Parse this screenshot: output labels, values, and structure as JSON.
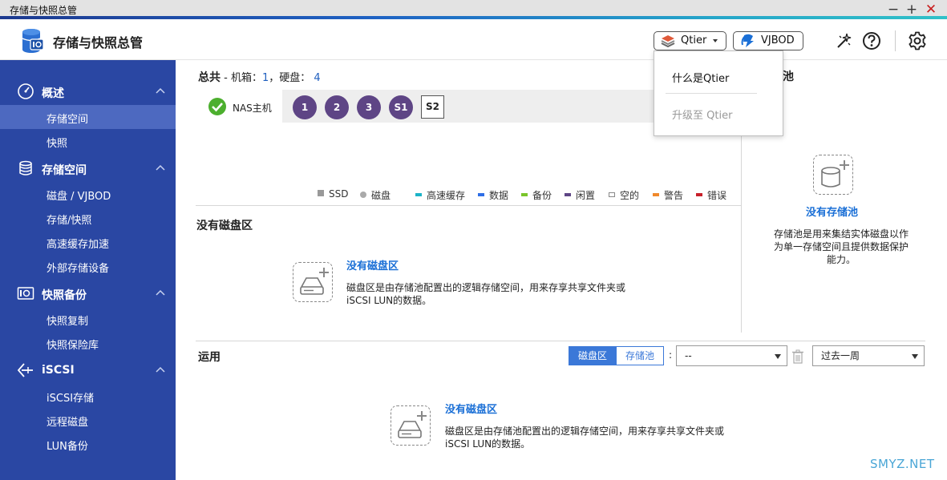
{
  "window": {
    "title": "存储与快照总管",
    "minimize": "−",
    "maximize": "+",
    "close": "✕"
  },
  "header": {
    "app_title": "存储与快照总管",
    "qtier_label": "Qtier",
    "vjbod_label": "VJBOD"
  },
  "qtier_menu": {
    "items": [
      {
        "label": "什么是Qtier",
        "enabled": true
      },
      {
        "label": "升级至 Qtier",
        "enabled": false
      }
    ]
  },
  "sidebar": {
    "sections": [
      {
        "label": "概述",
        "icon": "gauge-icon",
        "items": [
          "存储空间",
          "快照"
        ]
      },
      {
        "label": "存储空间",
        "icon": "database-icon",
        "items": [
          "磁盘 / VJBOD",
          "存储/快照",
          "高速缓存加速",
          "外部存储设备"
        ]
      },
      {
        "label": "快照备份",
        "icon": "camera-icon",
        "items": [
          "快照复制",
          "快照保险库"
        ]
      },
      {
        "label": "iSCSI",
        "icon": "iscsi-icon",
        "items": [
          "iSCSI存储",
          "远程磁盘",
          "LUN备份"
        ]
      }
    ],
    "active_item": "存储空间"
  },
  "summary": {
    "total_label": "总共",
    "enclosure_label": "- 机箱：",
    "enclosure_count": "1",
    "separator": "，",
    "disk_label": "硬盘：",
    "disk_count": "4",
    "nas_label": "NAS主机",
    "disks": [
      "1",
      "2",
      "3",
      "S1",
      "S2"
    ]
  },
  "legend": [
    {
      "label": "SSD",
      "color": "#999999",
      "shape": "square"
    },
    {
      "label": "磁盘",
      "color": "#aaaaaa",
      "shape": "circle"
    },
    {
      "label": "高速缓存",
      "color": "#1bb3c8",
      "shape": "bar"
    },
    {
      "label": "数据",
      "color": "#2e6ee6",
      "shape": "bar"
    },
    {
      "label": "备份",
      "color": "#7ac52a",
      "shape": "bar"
    },
    {
      "label": "闲置",
      "color": "#5e4585",
      "shape": "bar"
    },
    {
      "label": "空的",
      "color": "#ffffff",
      "shape": "bar"
    },
    {
      "label": "警告",
      "color": "#f0892b",
      "shape": "bar"
    },
    {
      "label": "错误",
      "color": "#c8202a",
      "shape": "bar"
    }
  ],
  "volume_section": {
    "title": "没有磁盘区",
    "empty_title": "没有磁盘区",
    "empty_desc_line1": "磁盘区是由存储池配置出的逻辑存储空间，用来存享共享文件夹或",
    "empty_desc_line2": "iSCSI LUN的数据。"
  },
  "pool_panel": {
    "title": "池",
    "empty_title": "没有存储池",
    "desc_line1": "存储池是用来集结实体磁盘以作",
    "desc_line2": "为单一存储空间且提供数据保护",
    "desc_line3": "能力。"
  },
  "usage": {
    "title": "运用",
    "tab_volume": "磁盘区",
    "tab_pool": "存储池",
    "colon": ":",
    "select_value": "--",
    "period_value": "过去一周",
    "empty_title": "没有磁盘区",
    "empty_desc_line1": "磁盘区是由存储池配置出的逻辑存储空间，用来存享共享文件夹或",
    "empty_desc_line2": "iSCSI LUN的数据。"
  },
  "watermark": "SMYZ.NET"
}
